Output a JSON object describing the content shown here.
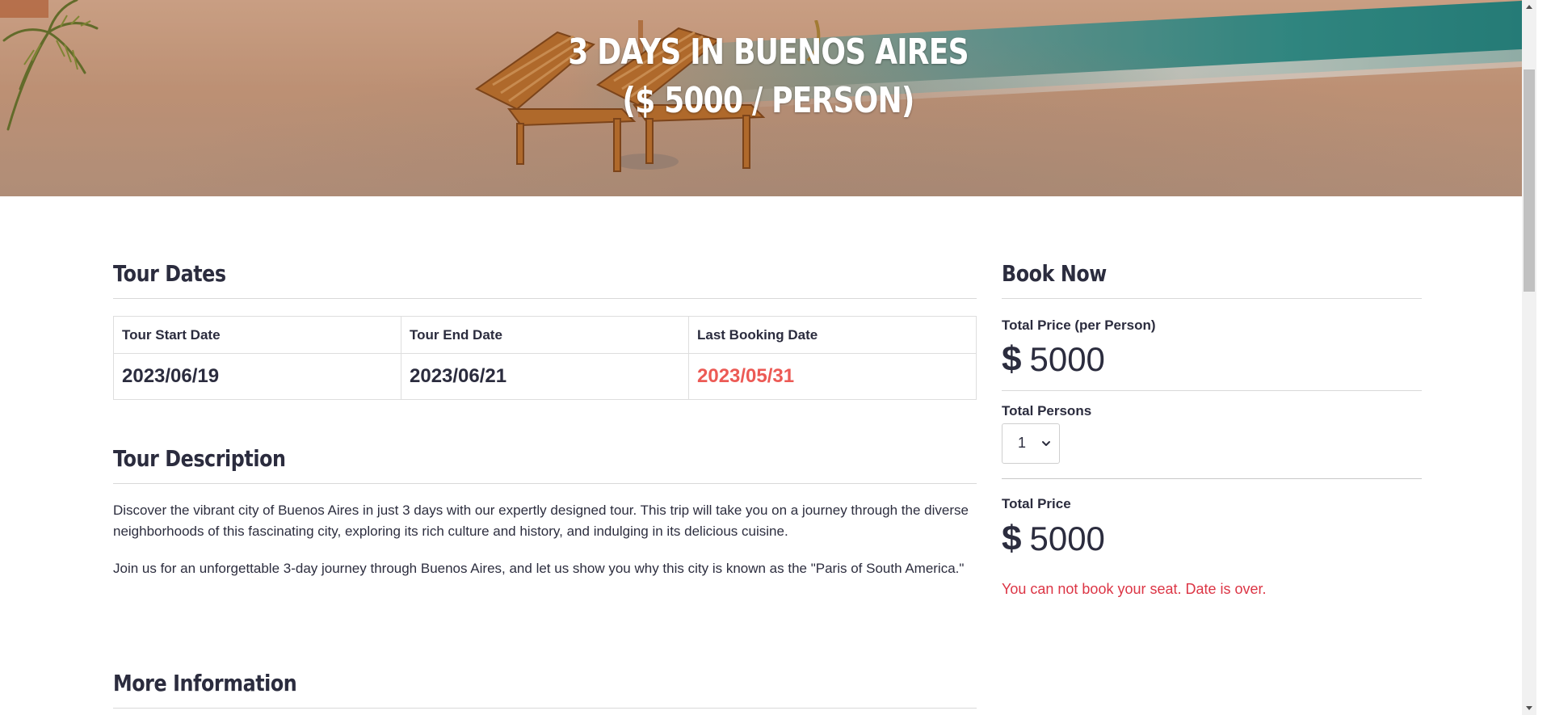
{
  "hero": {
    "title_line1": "3 Days in Buenos Aires",
    "title_line2": "($ 5000 / Person)"
  },
  "tour_dates": {
    "heading": "Tour Dates",
    "columns": [
      "Tour Start Date",
      "Tour End Date",
      "Last Booking Date"
    ],
    "values": [
      "2023/06/19",
      "2023/06/21",
      "2023/05/31"
    ],
    "expired_color": "#ec5a55"
  },
  "tour_description": {
    "heading": "Tour Description",
    "paragraphs": [
      "Discover the vibrant city of Buenos Aires in just 3 days with our expertly designed tour. This trip will take you on a journey through the diverse neighborhoods of this fascinating city, exploring its rich culture and history, and indulging in its delicious cuisine.",
      "Join us for an unforgettable 3-day journey through Buenos Aires, and let us show you why this city is known as the \"Paris of South America.\""
    ]
  },
  "more_information": {
    "heading": "More Information"
  },
  "book_now": {
    "heading": "Book Now",
    "price_per_person_label": "Total Price (per Person)",
    "currency_symbol": "$",
    "price_per_person": "5000",
    "total_persons_label": "Total Persons",
    "total_persons_selected": "1",
    "total_price_label": "Total Price",
    "total_price": "5000",
    "error_message": "You can not book your seat. Date is over.",
    "error_color": "#dc3545"
  },
  "icons": {
    "select_chevron": "chevron-down-icon",
    "scroll_up": "scroll-up-arrow-icon",
    "scroll_down": "scroll-down-arrow-icon"
  }
}
